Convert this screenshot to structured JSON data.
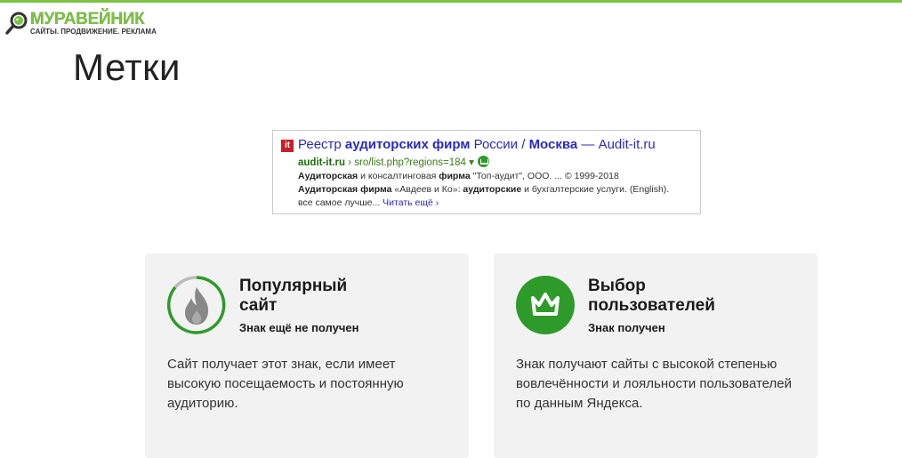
{
  "logo": {
    "name": "МУРАВЕЙНИК",
    "tagline": "САЙТЫ. ПРОДВИЖЕНИЕ. РЕКЛАМА",
    "icon": "magnifier-ant-icon"
  },
  "slide": {
    "title": "Метки"
  },
  "snippet": {
    "favicon": "it",
    "title_parts": [
      "Реестр ",
      "аудиторских фирм",
      " России / ",
      "Москва",
      " — Audit-it.ru"
    ],
    "url_domain": "audit-it.ru",
    "url_path": " › sro/list.php?regions=184 ▾",
    "line1": "Аудиторская и консалтинговая фирма \"Топ-аудит\", ООО. ... © 1999-2018",
    "line2": "Аудиторская фирма «Авдеев и Ко»: аудиторские и бухгалтерские услуги. (English).",
    "line3": "все самое лучше...",
    "read_more": "Читать ещё ›"
  },
  "cards": [
    {
      "heading_line1": "Популярный",
      "heading_line2": "сайт",
      "status": "Знак ещё не получен",
      "description": "Сайт получает этот знак, если имеет высокую посещаемость и постоянную аудиторию.",
      "icon": "flame-icon"
    },
    {
      "heading_line1": "Выбор",
      "heading_line2": "пользователей",
      "status": "Знак получен",
      "description": "Знак получают сайты с высокой степенью вовлечённости и лояльности пользователей по данным Яндекса.",
      "icon": "crown-icon"
    }
  ],
  "colors": {
    "accent_green": "#7cc243",
    "badge_green": "#2e9a2a",
    "link_blue": "#2a2ac0",
    "card_bg": "#f2f2f2"
  }
}
